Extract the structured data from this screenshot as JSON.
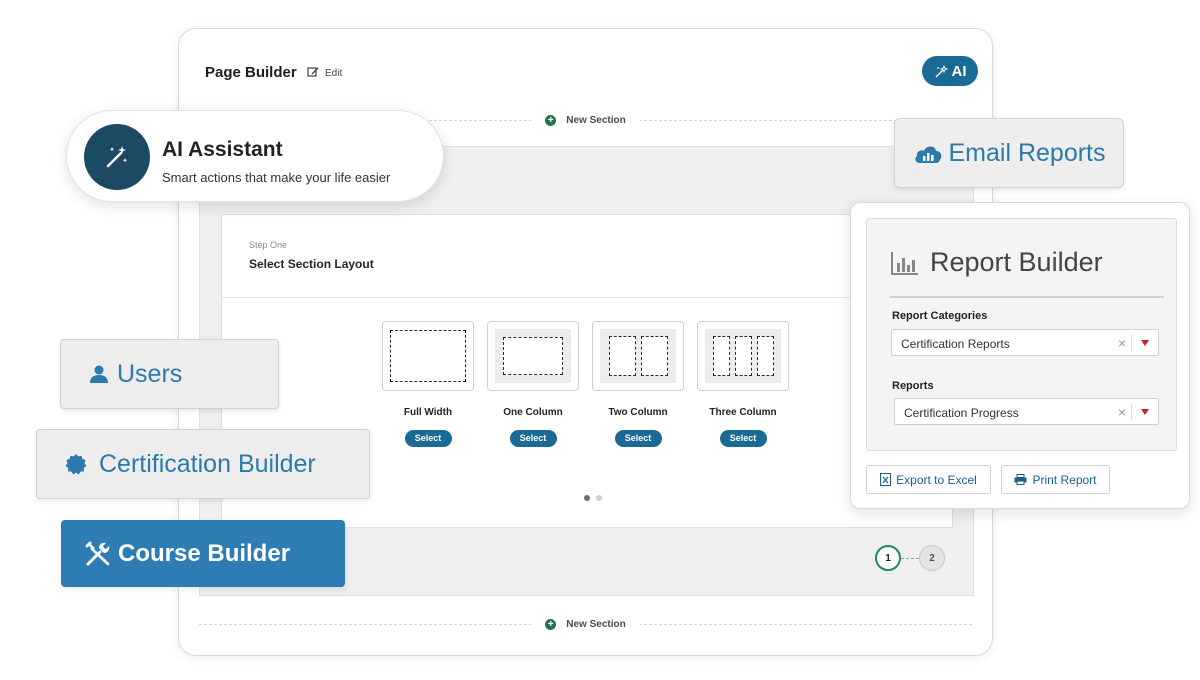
{
  "page_builder": {
    "title": "Page Builder",
    "edit_label": "Edit",
    "ai_button_label": "AI",
    "new_section_label": "New Section",
    "step_label": "Step One",
    "step_title": "Select Section Layout",
    "layouts": [
      {
        "name": "Full Width",
        "select_label": "Select"
      },
      {
        "name": "One Column",
        "select_label": "Select"
      },
      {
        "name": "Two Column",
        "select_label": "Select"
      },
      {
        "name": "Three Column",
        "select_label": "Select"
      }
    ],
    "pagination": {
      "current": 1,
      "total": 2
    },
    "steps": [
      "1",
      "2"
    ]
  },
  "ai_assistant": {
    "title": "AI Assistant",
    "subtitle": "Smart actions that make your life easier",
    "icon": "magic-wand-icon"
  },
  "email_reports": {
    "label": "Email Reports",
    "icon": "cloud-chart-icon"
  },
  "report_builder": {
    "title": "Report Builder",
    "icon": "bar-chart-icon",
    "categories_label": "Report Categories",
    "categories_value": "Certification Reports",
    "reports_label": "Reports",
    "reports_value": "Certification Progress",
    "export_label": "Export to Excel",
    "print_label": "Print Report"
  },
  "nav_tiles": {
    "users": {
      "label": "Users",
      "icon": "user-icon"
    },
    "certification": {
      "label": "Certification Builder",
      "icon": "badge-icon"
    },
    "course": {
      "label": "Course Builder",
      "icon": "tools-icon"
    }
  },
  "colors": {
    "brand_blue": "#1a6a96",
    "tile_blue": "#2c79ab",
    "dark_navy": "#1c4a63",
    "green": "#1e7a4d",
    "red_caret": "#c0262d"
  }
}
